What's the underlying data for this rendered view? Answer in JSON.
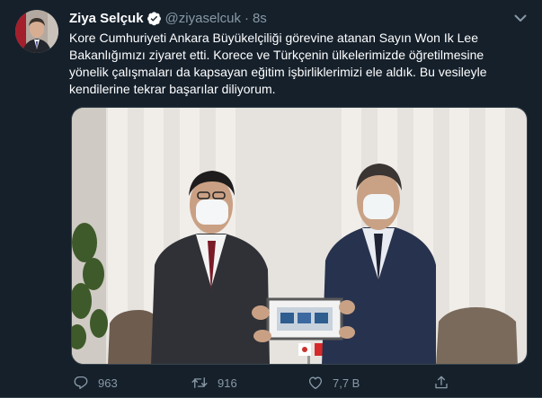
{
  "tweet": {
    "author_name": "Ziya Selçuk",
    "handle": "@ziyaselcuk",
    "separator": "·",
    "time": "8s",
    "text": "Kore Cumhuriyeti Ankara Büyükelçiliği görevine atanan Sayın Won Ik Lee\nBakanlığımızı ziyaret etti. Korece ve Türkçenin ülkelerimizde öğretilmesine\nyönelik çalışmaları da kapsayan eğitim işbirliklerimizi ele aldık. Bu vesileyle\nkendilerine tekrar başarılar diliyorum."
  },
  "actions": {
    "reply_count": "963",
    "retweet_count": "916",
    "like_count": "7,7 B"
  },
  "icons": {
    "verified": "verified-badge-icon",
    "caret": "chevron-down-icon",
    "reply": "reply-icon",
    "retweet": "retweet-icon",
    "like": "heart-icon",
    "share": "share-icon"
  },
  "colors": {
    "background": "#15202b",
    "text": "#ffffff",
    "secondary": "#8899a6",
    "verified": "#1da1f2",
    "border": "#38444d"
  }
}
